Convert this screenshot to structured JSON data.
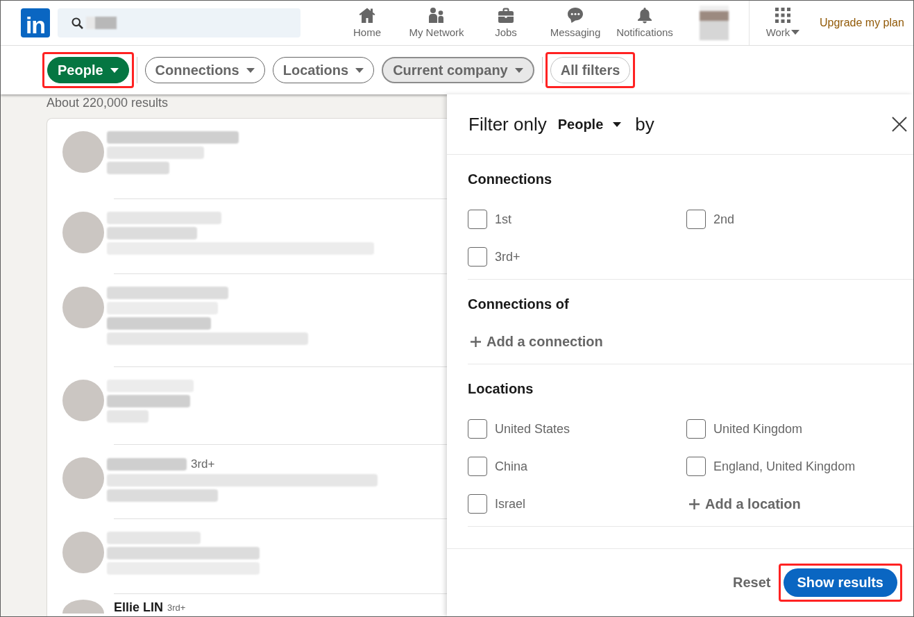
{
  "nav": {
    "logo": "in",
    "items": [
      {
        "kind": "home",
        "label": "Home"
      },
      {
        "kind": "network",
        "label": "My Network"
      },
      {
        "kind": "jobs",
        "label": "Jobs"
      },
      {
        "kind": "messaging",
        "label": "Messaging"
      },
      {
        "kind": "notifications",
        "label": "Notifications"
      }
    ],
    "work": "Work",
    "upgrade": "Upgrade my plan"
  },
  "filters": {
    "pills": [
      {
        "label": "People",
        "selected": true,
        "hovered": false,
        "highlighted": true
      },
      {
        "label": "Connections",
        "selected": false,
        "hovered": false,
        "highlighted": false
      },
      {
        "label": "Locations",
        "selected": false,
        "hovered": false,
        "highlighted": false
      },
      {
        "label": "Current company",
        "selected": false,
        "hovered": true,
        "highlighted": false
      }
    ],
    "all_filters": {
      "label": "All filters",
      "highlighted": true
    }
  },
  "results": {
    "count": "About 220,000 results",
    "rows": [
      {
        "kind": "blurred"
      },
      {
        "kind": "blurred"
      },
      {
        "kind": "blurred"
      },
      {
        "kind": "blurred"
      },
      {
        "kind": "blurred",
        "degree": "3rd+"
      },
      {
        "kind": "blurred"
      },
      {
        "kind": "named",
        "name": "Ellie LIN",
        "degree": "3rd+"
      }
    ]
  },
  "panel": {
    "title": "Filter only",
    "type": "People",
    "title_end": "by",
    "sections": [
      {
        "title": "Connections",
        "options": [
          {
            "label": "1st",
            "checked": false
          },
          {
            "label": "2nd",
            "checked": false
          },
          {
            "label": "3rd+",
            "checked": false
          }
        ]
      },
      {
        "title": "Connections of",
        "add": "Add a connection"
      },
      {
        "title": "Locations",
        "options": [
          {
            "label": "United States",
            "checked": false
          },
          {
            "label": "United Kingdom",
            "checked": false
          },
          {
            "label": "China",
            "checked": false
          },
          {
            "label": "England, United Kingdom",
            "checked": false
          },
          {
            "label": "Israel",
            "checked": false
          }
        ],
        "add": "Add a location"
      }
    ],
    "reset": "Reset",
    "show_results": {
      "label": "Show results",
      "highlighted": true
    }
  }
}
